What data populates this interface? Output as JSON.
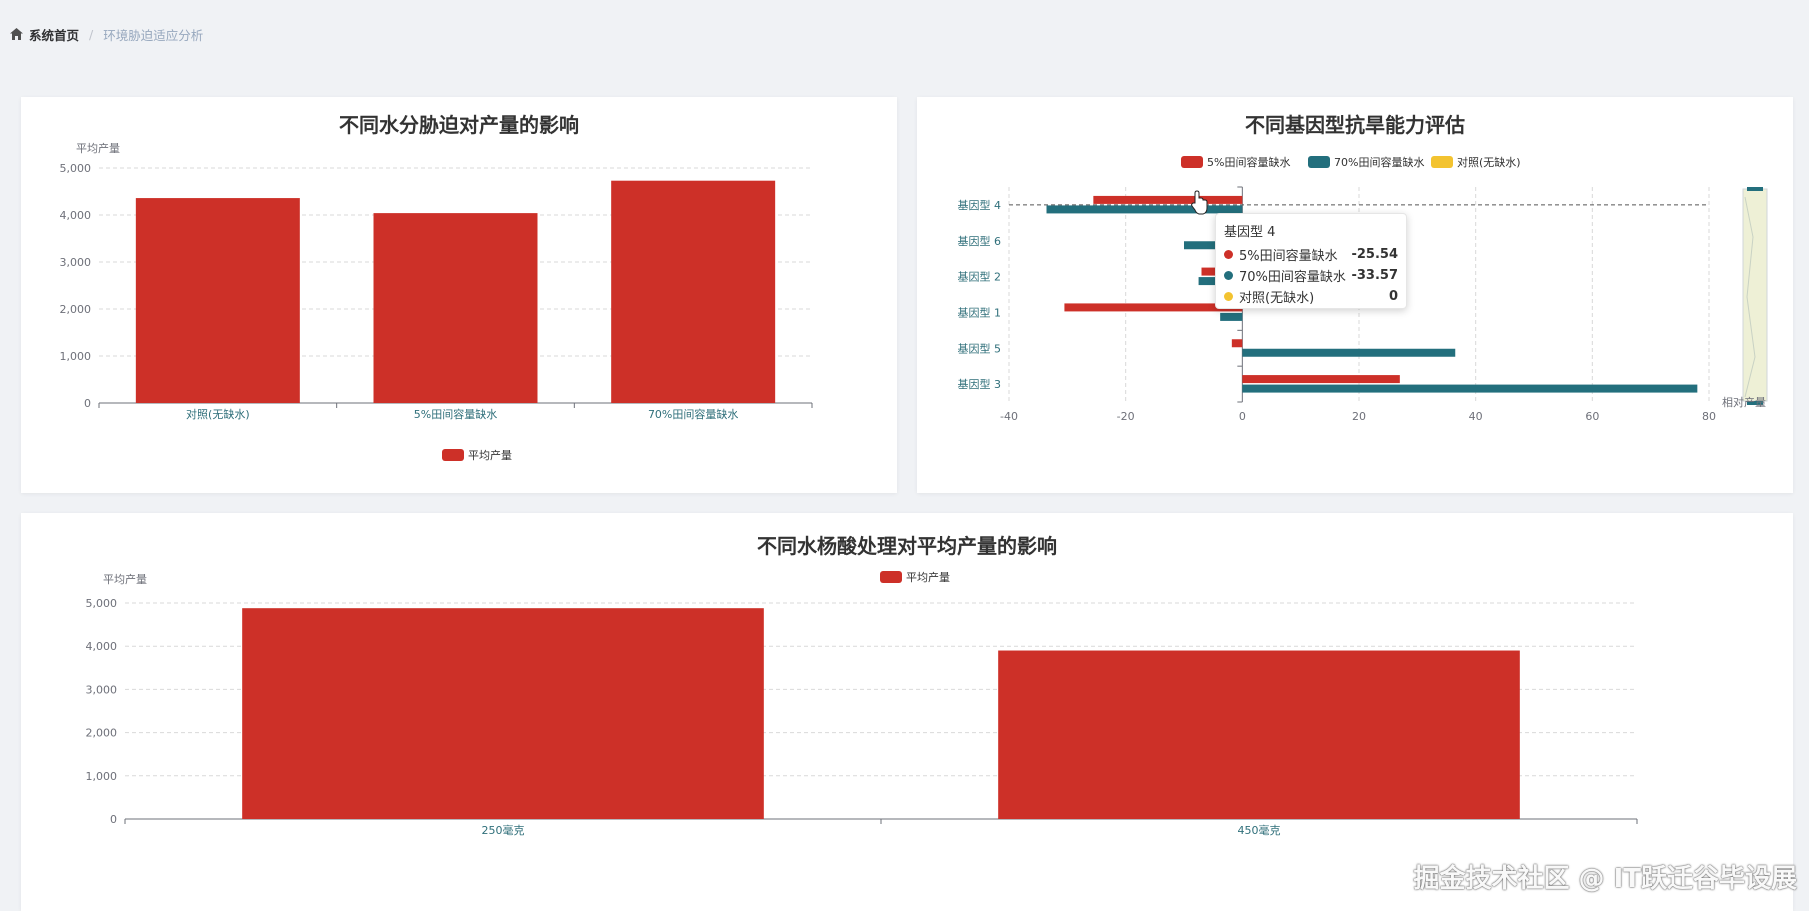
{
  "breadcrumb": {
    "home": "系统首页",
    "current": "环境胁迫适应分析"
  },
  "colors": {
    "red": "#cd3028",
    "teal": "#236f7d",
    "yellow": "#f3c330"
  },
  "chart_data": [
    {
      "type": "bar",
      "title": "不同水分胁迫对产量的影响",
      "ylabel": "平均产量",
      "categories": [
        "对照(无缺水)",
        "5%田间容量缺水",
        "70%田间容量缺水"
      ],
      "series": [
        {
          "name": "平均产量",
          "values": [
            4360,
            4040,
            4730
          ]
        }
      ],
      "ylim": [
        0,
        5000
      ],
      "yticks": [
        "0",
        "1,000",
        "2,000",
        "3,000",
        "4,000",
        "5,000"
      ],
      "legend": "bottom",
      "grid": true
    },
    {
      "type": "bar",
      "orientation": "horizontal",
      "title": "不同基因型抗旱能力评估",
      "xlabel": "相对产量",
      "categories": [
        "基因型 4",
        "基因型 6",
        "基因型 2",
        "基因型 1",
        "基因型 5",
        "基因型 3"
      ],
      "series": [
        {
          "name": "5%田间容量缺水",
          "values": [
            -25.54,
            -3,
            -7,
            -30.5,
            -1.8,
            27
          ]
        },
        {
          "name": "70%田间容量缺水",
          "values": [
            -33.57,
            -10,
            -7.5,
            -3.8,
            36.5,
            78
          ]
        },
        {
          "name": "对照(无缺水)",
          "values": [
            0,
            0,
            0,
            0,
            0,
            0
          ]
        }
      ],
      "xlim": [
        -40,
        80
      ],
      "xticks": [
        "-40",
        "-20",
        "0",
        "20",
        "40",
        "60",
        "80"
      ],
      "legend": "top",
      "grid": true,
      "tooltip": {
        "title": "基因型 4",
        "rows": [
          {
            "name": "5%田间容量缺水",
            "value": "-25.54"
          },
          {
            "name": "70%田间容量缺水",
            "value": "-33.57"
          },
          {
            "name": "对照(无缺水)",
            "value": "0"
          }
        ]
      }
    },
    {
      "type": "bar",
      "title": "不同水杨酸处理对平均产量的影响",
      "ylabel": "平均产量",
      "categories": [
        "250毫克",
        "450毫克"
      ],
      "series": [
        {
          "name": "平均产量",
          "values": [
            4880,
            3900
          ]
        }
      ],
      "ylim": [
        0,
        5000
      ],
      "yticks": [
        "0",
        "1,000",
        "2,000",
        "3,000",
        "4,000",
        "5,000"
      ],
      "legend": "top",
      "grid": true
    }
  ],
  "watermark": "掘金技术社区 @ IT跃迁谷毕设展"
}
